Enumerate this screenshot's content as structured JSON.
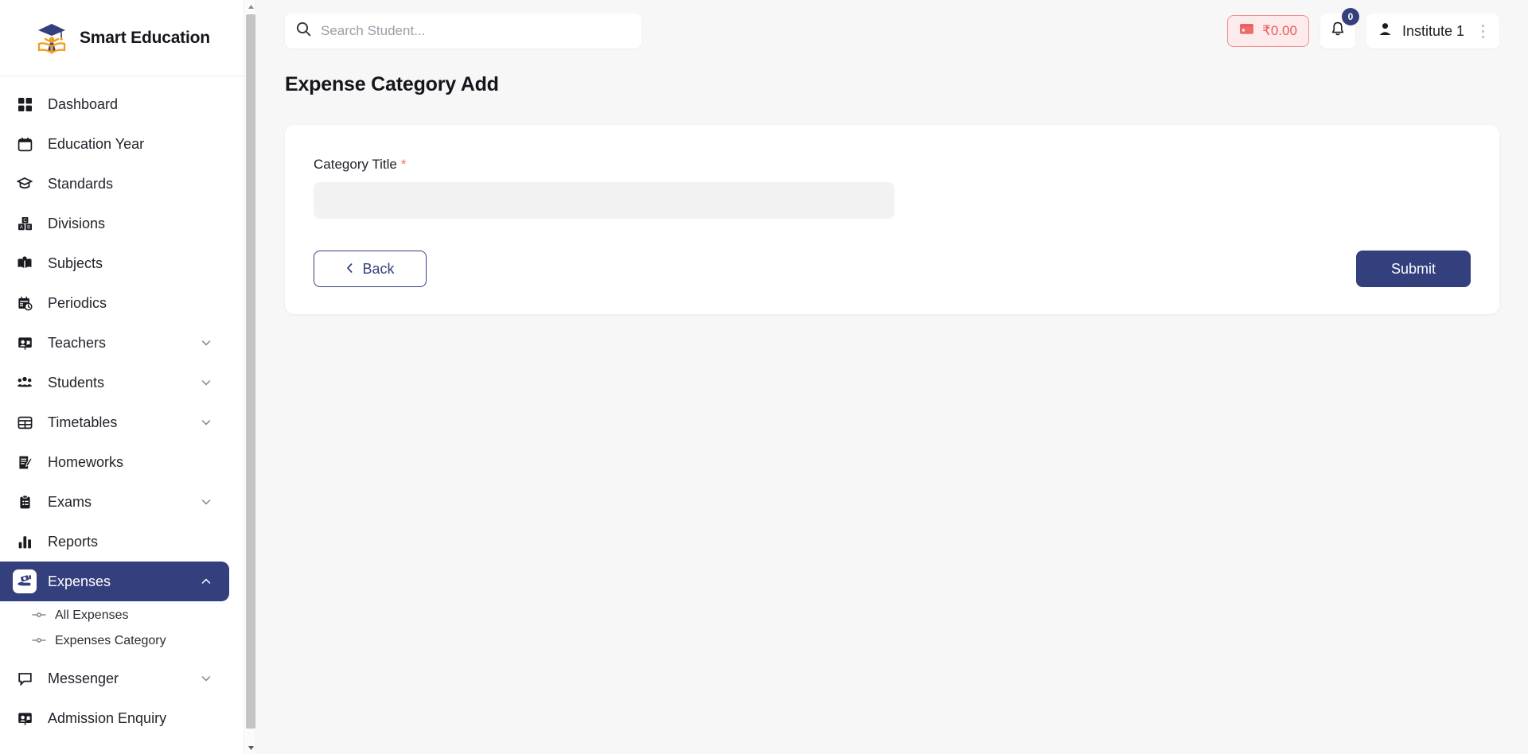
{
  "brand": {
    "name": "Smart Education",
    "logo_icon": "graduation-cap-book-logo"
  },
  "colors": {
    "accent_navy": "#343f7d",
    "wallet_red": "#e8595b",
    "wallet_bg": "#fdebec",
    "required_asterisk": "#ef7271",
    "page_bg": "#f7f7f8",
    "card_bg": "#ffffff",
    "input_bg": "#f2f2f3"
  },
  "search": {
    "placeholder": "Search Student...",
    "value": "",
    "icon": "search-icon"
  },
  "topbar": {
    "wallet": {
      "amount": "₹0.00",
      "icon": "wallet-icon"
    },
    "notifications": {
      "count": "0",
      "icon": "bell-icon"
    },
    "user": {
      "name": "Institute 1",
      "icon": "user-icon",
      "menu_icon": "vertical-dots-icon"
    }
  },
  "page": {
    "title": "Expense Category Add"
  },
  "form": {
    "category_title": {
      "label": "Category Title",
      "required_mark": "*",
      "value": "",
      "placeholder": ""
    },
    "back_label": "Back",
    "back_icon": "chevron-left-icon",
    "submit_label": "Submit"
  },
  "sidebar": {
    "items": [
      {
        "label": "Dashboard",
        "icon": "grid-dashboard-icon",
        "active": false,
        "expandable": false
      },
      {
        "label": "Education Year",
        "icon": "calendar-icon",
        "active": false,
        "expandable": false
      },
      {
        "label": "Standards",
        "icon": "graduation-cap-icon",
        "active": false,
        "expandable": false
      },
      {
        "label": "Divisions",
        "icon": "abc-blocks-icon",
        "active": false,
        "expandable": false
      },
      {
        "label": "Subjects",
        "icon": "open-book-icon",
        "active": false,
        "expandable": false
      },
      {
        "label": "Periodics",
        "icon": "calendar-clock-icon",
        "active": false,
        "expandable": false
      },
      {
        "label": "Teachers",
        "icon": "teacher-board-icon",
        "active": false,
        "expandable": true
      },
      {
        "label": "Students",
        "icon": "users-group-icon",
        "active": false,
        "expandable": true
      },
      {
        "label": "Timetables",
        "icon": "table-grid-icon",
        "active": false,
        "expandable": true
      },
      {
        "label": "Homeworks",
        "icon": "notebook-pencil-icon",
        "active": false,
        "expandable": false
      },
      {
        "label": "Exams",
        "icon": "clipboard-list-icon",
        "active": false,
        "expandable": true
      },
      {
        "label": "Reports",
        "icon": "bar-chart-icon",
        "active": false,
        "expandable": false
      },
      {
        "label": "Expenses",
        "icon": "hand-money-icon",
        "active": true,
        "expandable": true,
        "expanded": true,
        "children": [
          {
            "label": "All Expenses",
            "icon": "dash-circle-bullet-icon"
          },
          {
            "label": "Expenses Category",
            "icon": "dash-circle-bullet-icon"
          }
        ]
      },
      {
        "label": "Messenger",
        "icon": "chat-bubble-icon",
        "active": false,
        "expandable": true
      },
      {
        "label": "Admission Enquiry",
        "icon": "teacher-board-icon",
        "active": false,
        "expandable": false
      }
    ]
  },
  "scrollbar": {
    "up_icon": "triangle-up-icon",
    "down_icon": "triangle-down-icon"
  }
}
